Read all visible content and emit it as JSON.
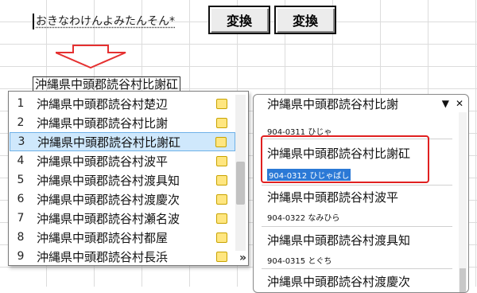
{
  "composition": "おきなわけんよみたんそん*",
  "buttons": {
    "convert1": "変換",
    "convert2": "変換"
  },
  "input": {
    "value": "沖縄県中頭郡読谷村比謝矼"
  },
  "candidates": [
    {
      "num": "1",
      "text": "沖縄県中頭郡読谷村楚辺"
    },
    {
      "num": "2",
      "text": "沖縄県中頭郡読谷村比謝"
    },
    {
      "num": "3",
      "text": "沖縄県中頭郡読谷村比謝矼"
    },
    {
      "num": "4",
      "text": "沖縄県中頭郡読谷村波平"
    },
    {
      "num": "5",
      "text": "沖縄県中頭郡読谷村渡具知"
    },
    {
      "num": "6",
      "text": "沖縄県中頭郡読谷村渡慶次"
    },
    {
      "num": "7",
      "text": "沖縄県中頭郡読谷村瀬名波"
    },
    {
      "num": "8",
      "text": "沖縄県中頭郡読谷村都屋"
    },
    {
      "num": "9",
      "text": "沖縄県中頭郡読谷村長浜"
    }
  ],
  "selected_index": 3,
  "expand_glyph": "»",
  "dictionary": {
    "menu_icon": "▼",
    "close_icon": "✕",
    "entries": [
      {
        "title": "沖縄県中頭郡読谷村比謝",
        "sub": "904-0311 ひじゃ"
      },
      {
        "title": "沖縄県中頭郡読谷村比謝矼",
        "sub": "904-0312 ひじゃばし"
      },
      {
        "title": "沖縄県中頭郡読谷村波平",
        "sub": "904-0322 なみひら"
      },
      {
        "title": "沖縄県中頭郡読谷村渡具知",
        "sub": "904-0315 とぐち"
      },
      {
        "title": "沖縄県中頭郡読谷村渡慶次",
        "sub": ""
      }
    ]
  },
  "colors": {
    "selection": "#cfe8fc",
    "highlight": "#2b79d6",
    "callout": "#e02020",
    "arrow": "#e53030"
  }
}
